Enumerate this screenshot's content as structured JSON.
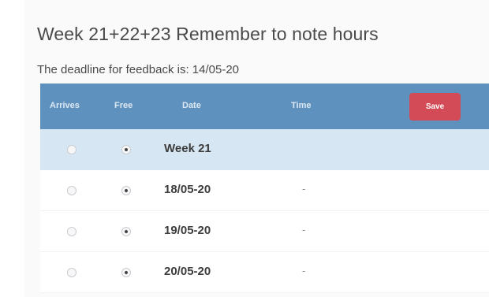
{
  "title": "Week 21+22+23 Remember to note hours",
  "deadline_text": "The deadline for feedback is: 14/05-20",
  "table": {
    "headers": {
      "arrives": "Arrives",
      "free": "Free",
      "date": "Date",
      "time": "Time"
    },
    "save_label": "Save",
    "week_row": {
      "label": "Week 21",
      "arrives_checked": false,
      "free_checked": true
    },
    "rows": [
      {
        "date": "18/05-20",
        "time": "-",
        "arrives_checked": false,
        "free_checked": true
      },
      {
        "date": "19/05-20",
        "time": "-",
        "arrives_checked": false,
        "free_checked": true
      },
      {
        "date": "20/05-20",
        "time": "-",
        "arrives_checked": false,
        "free_checked": true
      }
    ]
  },
  "colors": {
    "header_bg": "#5e91be",
    "save_button": "#d24b57",
    "week_row_bg": "#d6e6f2"
  }
}
